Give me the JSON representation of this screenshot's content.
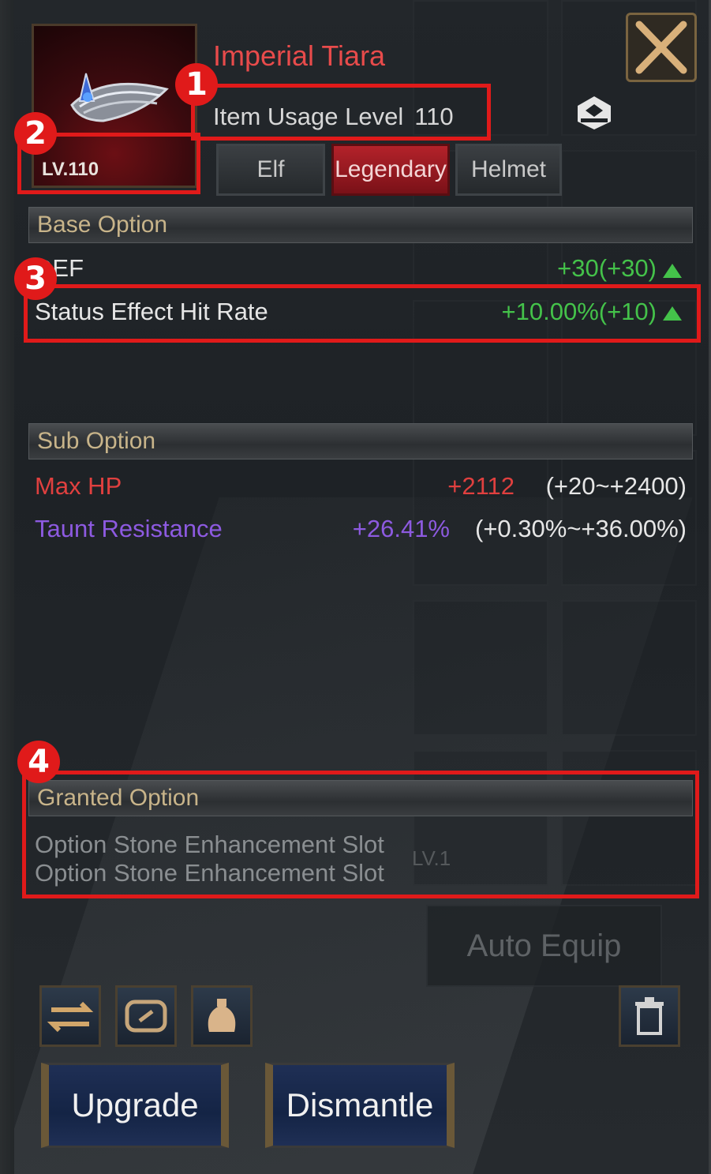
{
  "item": {
    "name": "Imperial Tiara",
    "level_badge": "LV.110",
    "usage_label": "Item Usage Level",
    "usage_value": "110",
    "tags": [
      "Elf",
      "Legendary",
      "Helmet"
    ]
  },
  "base_option": {
    "title": "Base Option",
    "rows": [
      {
        "label": "DEF",
        "value": "+30(+30)"
      },
      {
        "label": "Status Effect Hit Rate",
        "value": "+10.00%(+10)"
      }
    ]
  },
  "sub_option": {
    "title": "Sub Option",
    "rows": [
      {
        "label": "Max HP",
        "value": "+2112",
        "range": "(+20~+2400)"
      },
      {
        "label": "Taunt Resistance",
        "value": "+26.41%",
        "range": "(+0.30%~+36.00%)"
      }
    ]
  },
  "granted_option": {
    "title": "Granted Option",
    "slots": [
      "Option Stone Enhancement Slot",
      "Option Stone Enhancement Slot"
    ],
    "ghost_level": "LV.1"
  },
  "buttons": {
    "auto_equip": "Auto Equip",
    "upgrade": "Upgrade",
    "dismantle": "Dismantle"
  },
  "annotations": [
    "1",
    "2",
    "3",
    "4"
  ],
  "colors": {
    "item_name": "#e84b4b",
    "positive_stat": "#44c24a",
    "sub_hp": "#e0403f",
    "sub_taunt": "#8d5ae0",
    "annotation": "#e01a1a"
  },
  "icons": {
    "close": "close-x-icon",
    "gem": "option-stone-icon",
    "arrow_up": "stat-up-arrow-icon",
    "compare": "swap-icon",
    "link": "link-icon",
    "bag": "bag-icon",
    "trash": "trash-icon"
  }
}
